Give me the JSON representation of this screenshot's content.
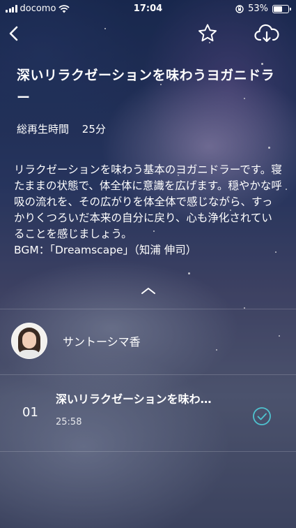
{
  "status_bar": {
    "carrier": "docomo",
    "time": "17:04",
    "battery": "53%",
    "battery_level": 0.53
  },
  "nav": {
    "back_icon": "chevron-left-icon",
    "favorite_icon": "star-outline-icon",
    "download_icon": "cloud-download-icon"
  },
  "program": {
    "title": "深いリラクゼーションを味わうヨガニドラー",
    "duration_label": "総再生時間",
    "duration_value": "25分",
    "description": "リラクゼーションを味わう基本のヨガニドラーです。寝たままの状態で、体全体に意識を広げます。穏やかな呼吸の流れを、その広がりを体全体で感じながら、すっかりくつろいだ本来の自分に戻り、心も浄化されていることを感じましょう。",
    "bgm": "BGM：「Dreamscape」（知浦 伸司）"
  },
  "performer": {
    "name": "サントーシマ香"
  },
  "tracks": [
    {
      "number": "01",
      "title": "深いリラクゼーションを味わ…",
      "time": "25:58",
      "completed": true
    }
  ],
  "colors": {
    "accent": "#4fc3d0"
  }
}
